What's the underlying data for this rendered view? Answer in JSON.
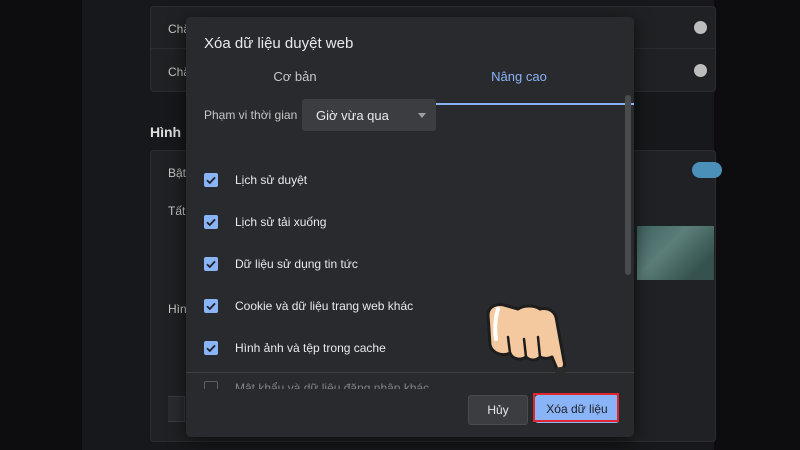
{
  "background": {
    "rows": [
      {
        "label": "Chặ"
      },
      {
        "label": "Chặ"
      }
    ],
    "section_heading": "Hình",
    "card_rows": [
      {
        "label": "Bật"
      },
      {
        "label": "Tất"
      },
      {
        "label": "Hìn"
      }
    ]
  },
  "dialog": {
    "title": "Xóa dữ liệu duyệt web",
    "tabs": [
      {
        "label": "Cơ bản"
      },
      {
        "label": "Nâng cao"
      }
    ],
    "time_range": {
      "label": "Phạm vi thời gian",
      "value": "Giờ vừa qua"
    },
    "items": [
      {
        "label": "Lịch sử duyệt",
        "checked": true
      },
      {
        "label": "Lịch sử tải xuống",
        "checked": true
      },
      {
        "label": "Dữ liệu sử dụng tin tức",
        "checked": true
      },
      {
        "label": "Cookie và dữ liệu trang web khác",
        "checked": true
      },
      {
        "label": "Hình ảnh và tệp trong cache",
        "checked": true
      },
      {
        "label": "Mật khẩu và dữ liệu đăng nhập khác",
        "checked": false
      }
    ],
    "buttons": {
      "cancel": "Hủy",
      "clear": "Xóa dữ liệu"
    }
  },
  "colors": {
    "accent": "#8ab4f8",
    "highlight": "#e0262f"
  }
}
